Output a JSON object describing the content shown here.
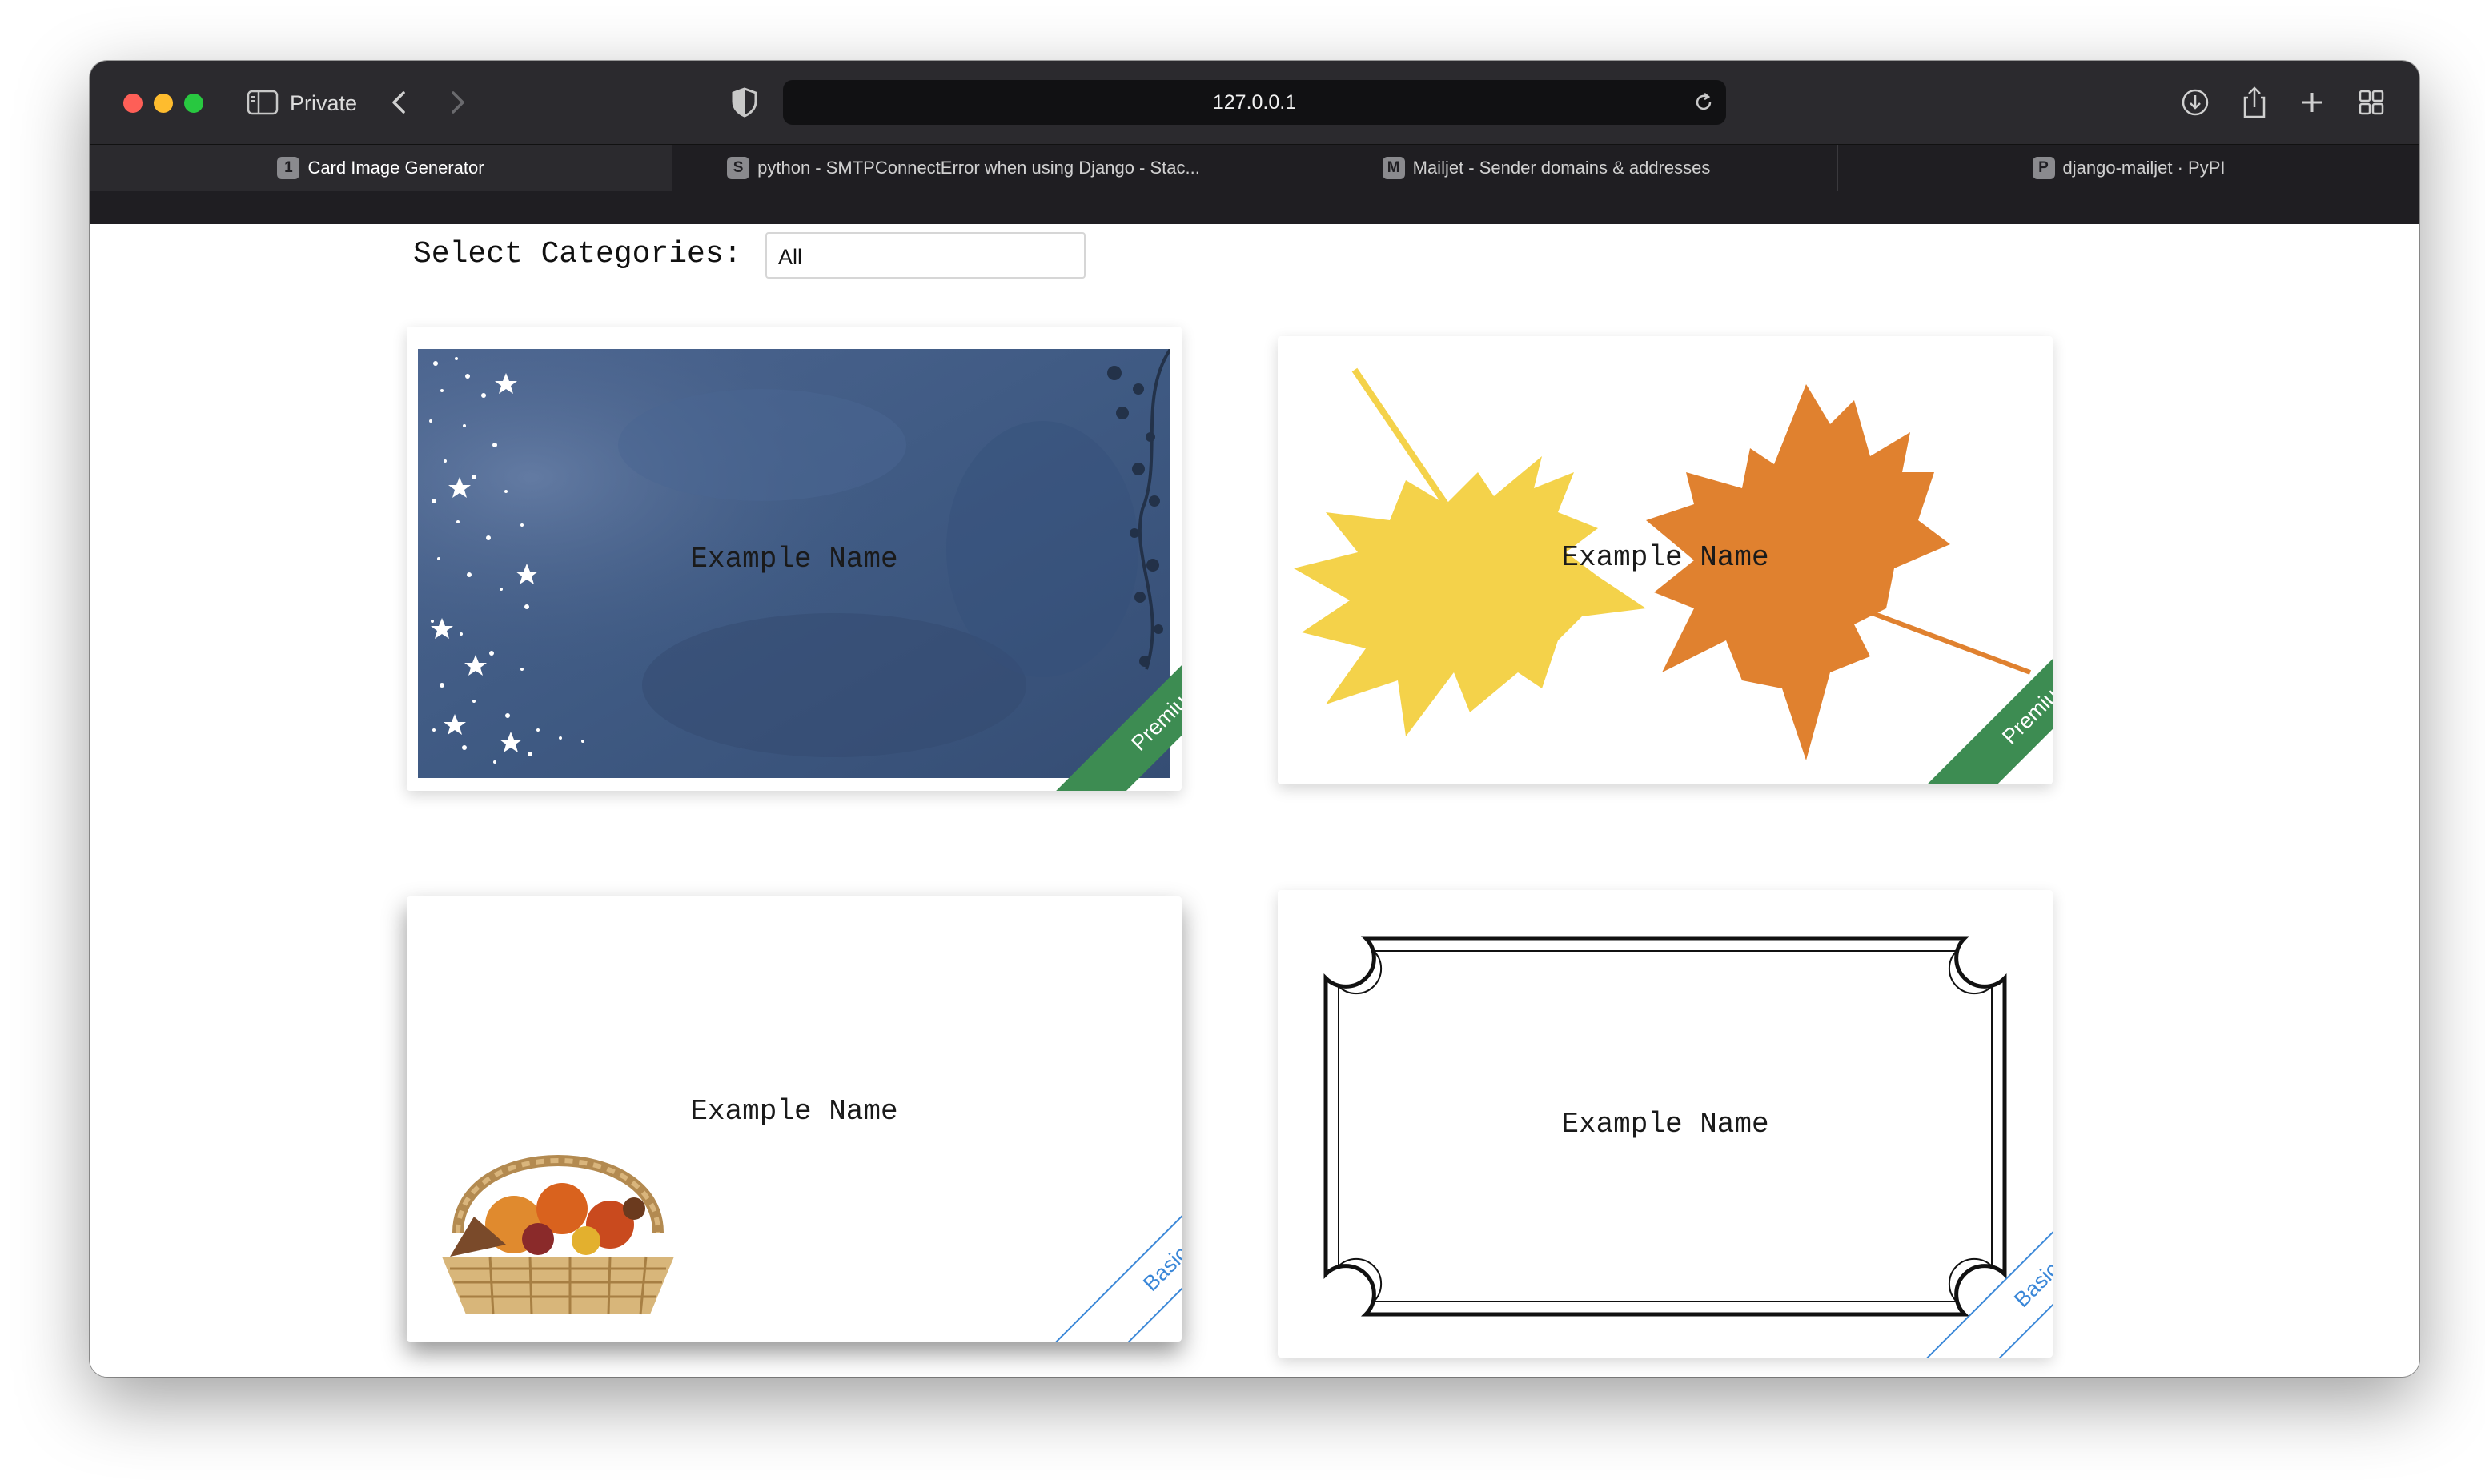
{
  "browser": {
    "mode_label": "Private",
    "url": "127.0.0.1",
    "tabs": [
      {
        "badge": "1",
        "title": "Card Image Generator",
        "active": true
      },
      {
        "badge": "S",
        "title": "python - SMTPConnectError when using Django - Stac..."
      },
      {
        "badge": "M",
        "title": "Mailjet - Sender domains & addresses"
      },
      {
        "badge": "P",
        "title": "django-mailjet · PyPI"
      }
    ]
  },
  "filter": {
    "label": "Select Categories:",
    "selected": "All"
  },
  "cards": [
    {
      "name": "Example Name",
      "tier": "Premium",
      "design": "night-sky-watercolor"
    },
    {
      "name": "Example Name",
      "tier": "Premium",
      "design": "autumn-maple-leaves"
    },
    {
      "name": "Example Name",
      "tier": "Basic",
      "design": "harvest-basket"
    },
    {
      "name": "Example Name",
      "tier": "Basic",
      "design": "ornate-border-frame"
    }
  ],
  "colors": {
    "premium_ribbon": "#3d8c52",
    "basic_ribbon": "#3a87d8",
    "night_sky": "#3f5a83",
    "leaf_yellow": "#f4d24a",
    "leaf_orange": "#e0812f"
  }
}
